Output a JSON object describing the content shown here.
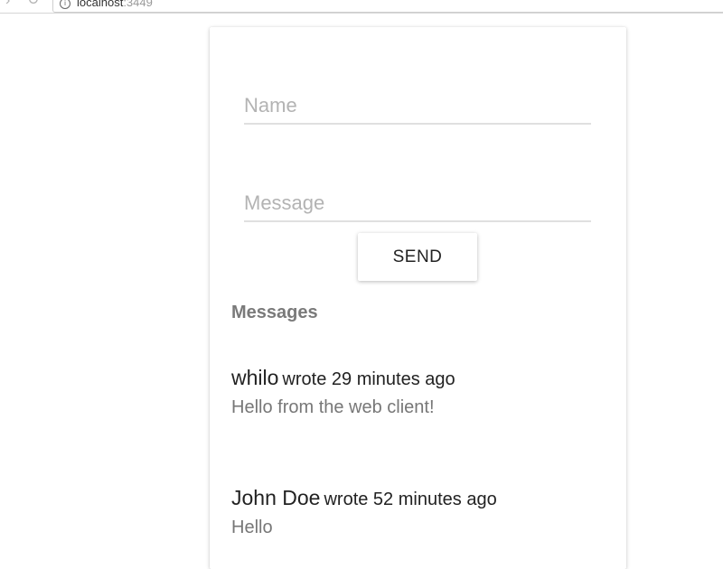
{
  "browser": {
    "url_host": "localhost",
    "url_port": ":3449",
    "nav_forward_icon": "chevron-right-icon",
    "reload_icon": "reload-icon",
    "info_icon": "info-icon"
  },
  "form": {
    "name_placeholder": "Name",
    "name_value": "",
    "message_placeholder": "Message",
    "message_value": "",
    "send_label": "SEND"
  },
  "messages": {
    "heading": "Messages",
    "items": [
      {
        "author": "whilo",
        "meta": "wrote 29 minutes ago",
        "body": "Hello from the web client!"
      },
      {
        "author": "John Doe",
        "meta": "wrote 52 minutes ago",
        "body": "Hello"
      }
    ]
  },
  "colors": {
    "card_background": "#ffffff",
    "placeholder": "#b3b3b3",
    "heading": "#7a7a7a",
    "body_text": "#777777",
    "author_text": "#222222"
  }
}
